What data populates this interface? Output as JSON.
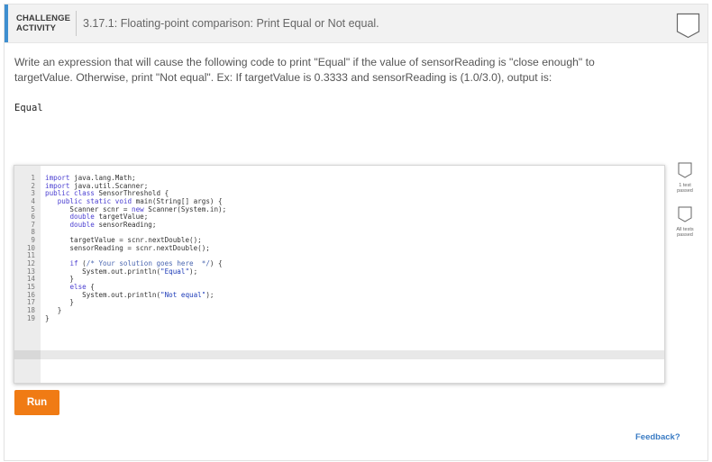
{
  "header": {
    "badge_line1": "CHALLENGE",
    "badge_line2": "ACTIVITY",
    "title": "3.17.1: Floating-point comparison: Print Equal or Not equal."
  },
  "description": "Write an expression that will cause the following code to print \"Equal\" if the value of sensorReading is \"close enough\" to targetValue. Otherwise, print \"Not equal\". Ex: If targetValue is 0.3333 and sensorReading is (1.0/3.0), output is:",
  "expected_output": "Equal",
  "code": {
    "lines": [
      {
        "n": "1",
        "text": "import java.lang.Math;"
      },
      {
        "n": "2",
        "text": "import java.util.Scanner;"
      },
      {
        "n": "3",
        "text": "public class SensorThreshold {"
      },
      {
        "n": "4",
        "text": "   public static void main(String[] args) {"
      },
      {
        "n": "5",
        "text": "      Scanner scnr = new Scanner(System.in);"
      },
      {
        "n": "6",
        "text": "      double targetValue;"
      },
      {
        "n": "7",
        "text": "      double sensorReading;"
      },
      {
        "n": "8",
        "text": ""
      },
      {
        "n": "9",
        "text": "      targetValue = scnr.nextDouble();"
      },
      {
        "n": "10",
        "text": "      sensorReading = scnr.nextDouble();"
      },
      {
        "n": "11",
        "text": ""
      },
      {
        "n": "12",
        "text": "      if (/* Your solution goes here  */) {"
      },
      {
        "n": "13",
        "text": "         System.out.println(\"Equal\");"
      },
      {
        "n": "14",
        "text": "      }"
      },
      {
        "n": "15",
        "text": "      else {"
      },
      {
        "n": "16",
        "text": "         System.out.println(\"Not equal\");"
      },
      {
        "n": "17",
        "text": "      }"
      },
      {
        "n": "18",
        "text": "   }"
      },
      {
        "n": "19",
        "text": "}"
      }
    ]
  },
  "tests": {
    "test1_label_line1": "1 test",
    "test1_label_line2": "passed",
    "test2_label_line1": "All tests",
    "test2_label_line2": "passed"
  },
  "run_label": "Run",
  "feedback_label": "Feedback?",
  "colors": {
    "accent": "#3f8fd0",
    "run_button": "#f07b14",
    "link": "#3b7cc4",
    "keyword": "#4a3ed1"
  },
  "icons": [
    "completion-check-icon",
    "test-passed-icon",
    "all-tests-passed-icon"
  ]
}
